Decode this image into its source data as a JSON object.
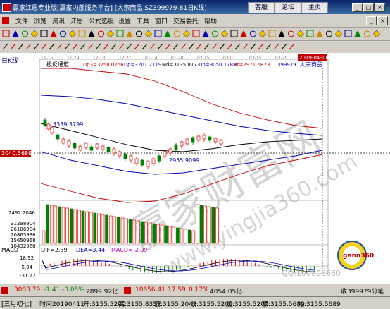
{
  "window": {
    "title": "赢家江恩专业版[赢家内部服务平台]  [大宗商品  SZ399979-81日K线]",
    "links": [
      "客服",
      "论坛",
      "主页"
    ],
    "controls": [
      "_",
      "□",
      "×"
    ]
  },
  "menu": [
    "文件",
    "浏览",
    "资讯",
    "江恩",
    "公式选股",
    "设置",
    "工具",
    "窗口",
    "交易委托",
    "帮助"
  ],
  "chart_header": {
    "period_label": "日K线",
    "indicator_name": "极反通道",
    "up3": "Up3=3258.0256",
    "up": "Up=3201.2119",
    "md": "Md=3135.8173",
    "dn": "Dn=3050.1788",
    "bt": "Bt=2971.6823",
    "code": "399979",
    "name": "大宗商品",
    "date_marker": "2019-04-11",
    "time_ticks": [
      "11-15",
      "11-29",
      "12-13",
      "12-27",
      "01-14",
      "01-28",
      "02-15",
      "03-01",
      "03-15",
      "03-29"
    ]
  },
  "price_labels": {
    "high_annot": "3339.3799",
    "low_annot": "2955.9099",
    "current_price": "3040.5689"
  },
  "volume": {
    "max_label": "2492.2046",
    "ticks": [
      "31298904",
      "26106904",
      "20865936",
      "15650968",
      "10432968"
    ]
  },
  "macd": {
    "name": "MACD",
    "dif": "DIF=2.39",
    "dea": "DEA=3.44",
    "macd": "MACD=-2.09",
    "ticks": [
      "18.92",
      "-5.94",
      "-31.72"
    ]
  },
  "watermark": {
    "text1": "赢家财富网",
    "text2": "www.yingjia360.com",
    "qq": "QQ:100806680",
    "logo": "gann360"
  },
  "status": {
    "sh_index": "3083.79",
    "sh_change": "-1.41",
    "sh_pct": "-0.05%",
    "sh_amount": "2899.92亿",
    "sz_index": "10656.41",
    "sz_change": "17.59",
    "sz_pct": "0.17%",
    "sz_amount": "4054.05亿",
    "right_text": "收399979分笔"
  },
  "infobar": {
    "lunar": "[三月初七]",
    "time": "时间20190411",
    "open": "开:3155.5200",
    "high": "高:3155.8357",
    "low": "低:3155.2043",
    "close": "收:3155.5200",
    "vol": "量:3155.5200",
    "amount": "额:3155.5689",
    "amp": "幅:3155.5689"
  },
  "colors": {
    "up": "#e00000",
    "down": "#008000",
    "envelope_outer": "#c00000",
    "envelope_inner": "#0000c0",
    "mid": "#000000",
    "grid": "#808080"
  }
}
